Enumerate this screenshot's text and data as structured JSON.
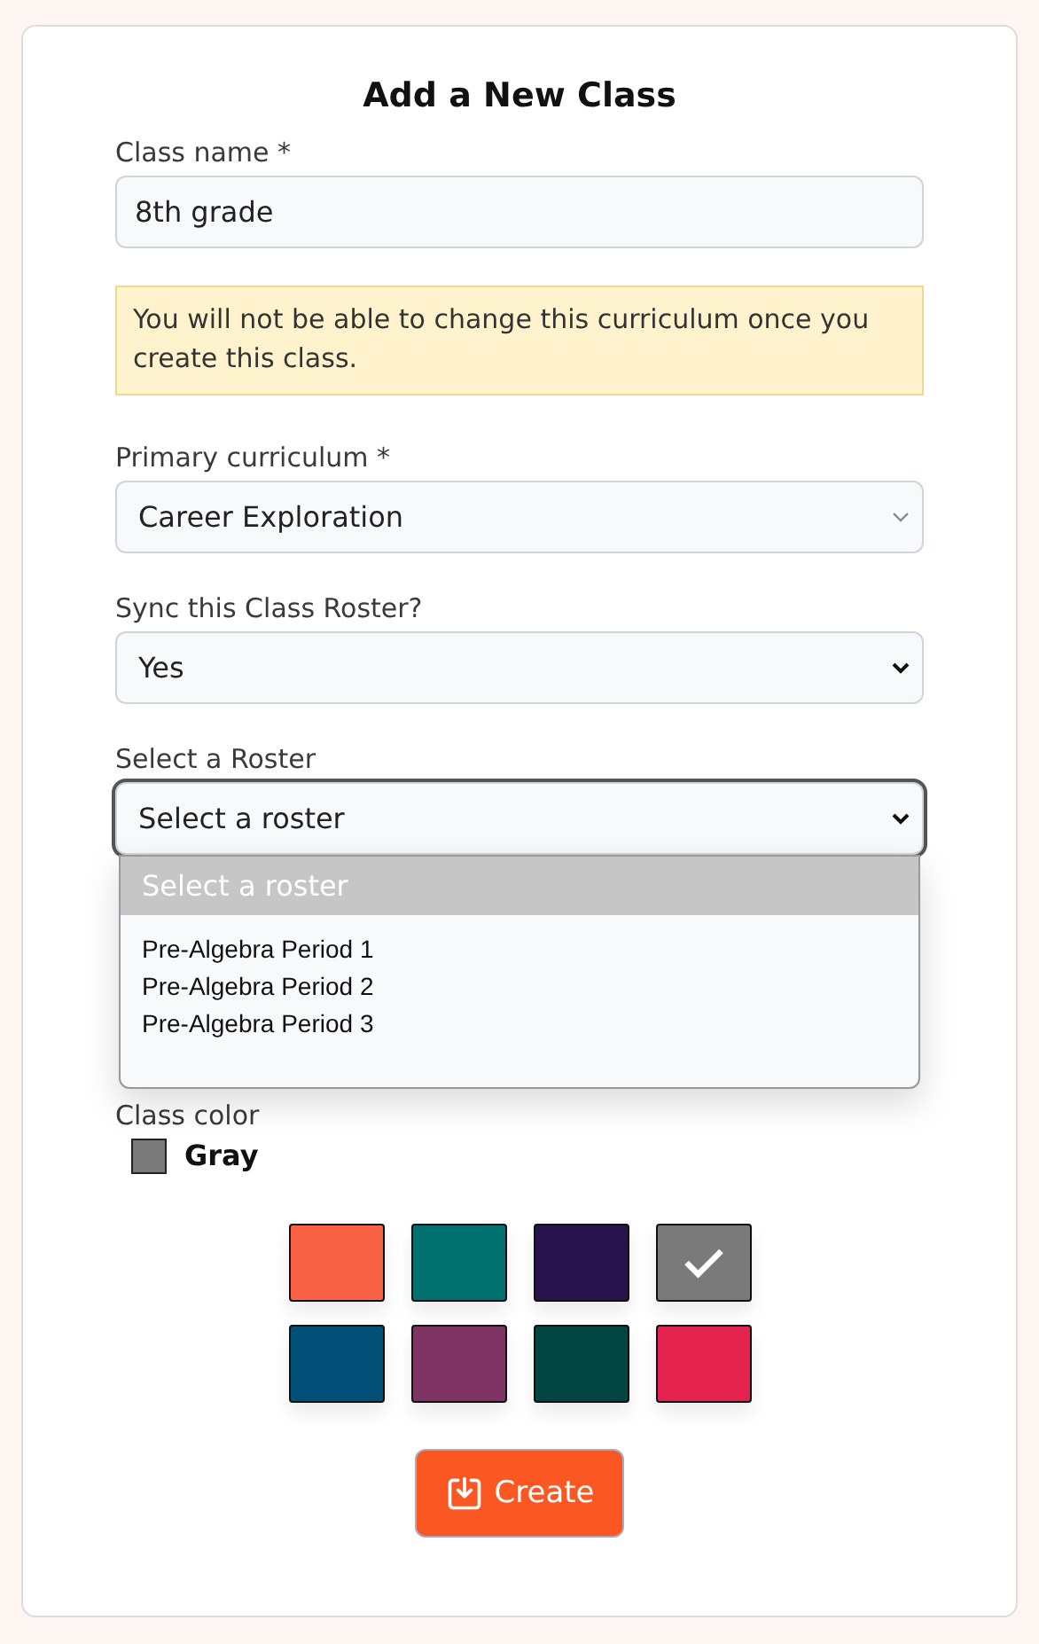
{
  "title": "Add a New Class",
  "fields": [
    {
      "kind": "text",
      "label": "Class name *",
      "value": "8th grade"
    },
    {
      "kind": "notice",
      "text": "You will not be able to change this curriculum once you create this class."
    },
    {
      "kind": "select",
      "label": "Primary curriculum *",
      "value": "Career Exploration",
      "disabled": true,
      "focused": false
    },
    {
      "kind": "select",
      "label": "Sync this Class Roster?",
      "value": "Yes",
      "disabled": false,
      "focused": false
    },
    {
      "kind": "select",
      "label": "Select a Roster",
      "value": "Select a roster",
      "disabled": false,
      "focused": true,
      "open": true,
      "options": [
        {
          "label": "Select a roster",
          "selected": true
        },
        {
          "label": "Pre-Algebra Period 1",
          "selected": false
        },
        {
          "label": "Pre-Algebra Period 2",
          "selected": false
        },
        {
          "label": "Pre-Algebra Period 3",
          "selected": false
        }
      ]
    }
  ],
  "class_color": {
    "label": "Class color",
    "value": "Gray",
    "color": "#7a7a7a",
    "swatches": [
      {
        "color": "#f96244",
        "selected": false
      },
      {
        "color": "#01706f",
        "selected": false
      },
      {
        "color": "#27144d",
        "selected": false
      },
      {
        "color": "#7a7a7a",
        "selected": true
      },
      {
        "color": "#014f76",
        "selected": false
      },
      {
        "color": "#7f3463",
        "selected": false
      },
      {
        "color": "#034540",
        "selected": false
      },
      {
        "color": "#e4244f",
        "selected": false
      }
    ]
  },
  "button": {
    "label": "Create"
  }
}
